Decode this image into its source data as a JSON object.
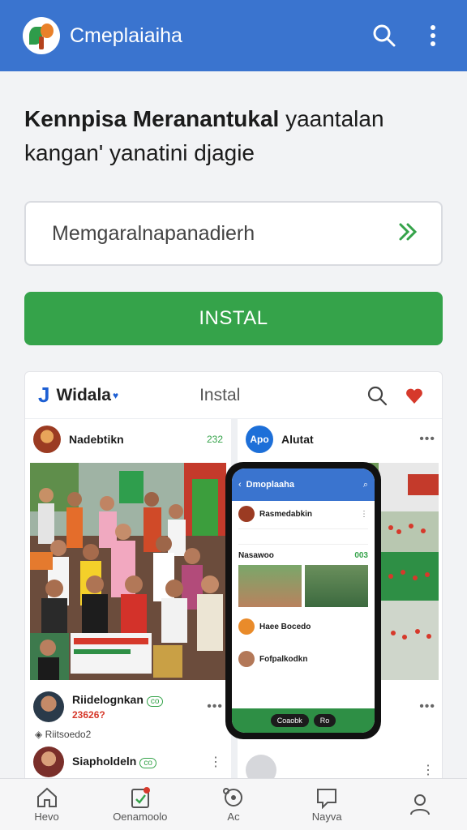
{
  "appbar": {
    "title": "Cmeplaiaiha",
    "icons": [
      "logo-icon",
      "search-icon",
      "more-vert-icon"
    ]
  },
  "headline": {
    "bold": "Kennpisa Meranantukal",
    "rest": "yaantalan",
    "line2": "kangan' yanatini djagie"
  },
  "search": {
    "value": "Memgaralnapanadierh",
    "action_icon": "chevron-double-right-icon"
  },
  "install_button": {
    "label": "INSTAL"
  },
  "preview_card": {
    "brand": "Widala",
    "tab": "Instal",
    "left_post": {
      "author": "Nadebtikn",
      "meta": "232",
      "comment_1": {
        "name": "Riidelognkan",
        "sub": "23626?"
      },
      "reply_label": "Riitsoedo2",
      "comment_2": {
        "name": "Siapholdeln"
      }
    },
    "right_post": {
      "author": "Alutat",
      "avatar_text": "Apo",
      "phone": {
        "title": "Dmoplaaha",
        "row_1": "Rasmedabkin",
        "row_2": "Nasawoo",
        "row_2_meta": "003",
        "row_3": "Haee Bocedo",
        "row_4": "Fofpalkodkn",
        "pill_1": "Coaobk",
        "pill_2": "Ro"
      }
    }
  },
  "bottom_nav": [
    {
      "label": "Hevo",
      "icon": "home-icon"
    },
    {
      "label": "Oenamoolo",
      "icon": "clipboard-icon"
    },
    {
      "label": "Ac",
      "icon": "explore-icon"
    },
    {
      "label": "Nayva",
      "icon": "chat-icon"
    },
    {
      "label": "",
      "icon": "profile-icon"
    }
  ],
  "colors": {
    "primary": "#3a74cf",
    "accent": "#35a34a",
    "heart": "#d6392b"
  }
}
